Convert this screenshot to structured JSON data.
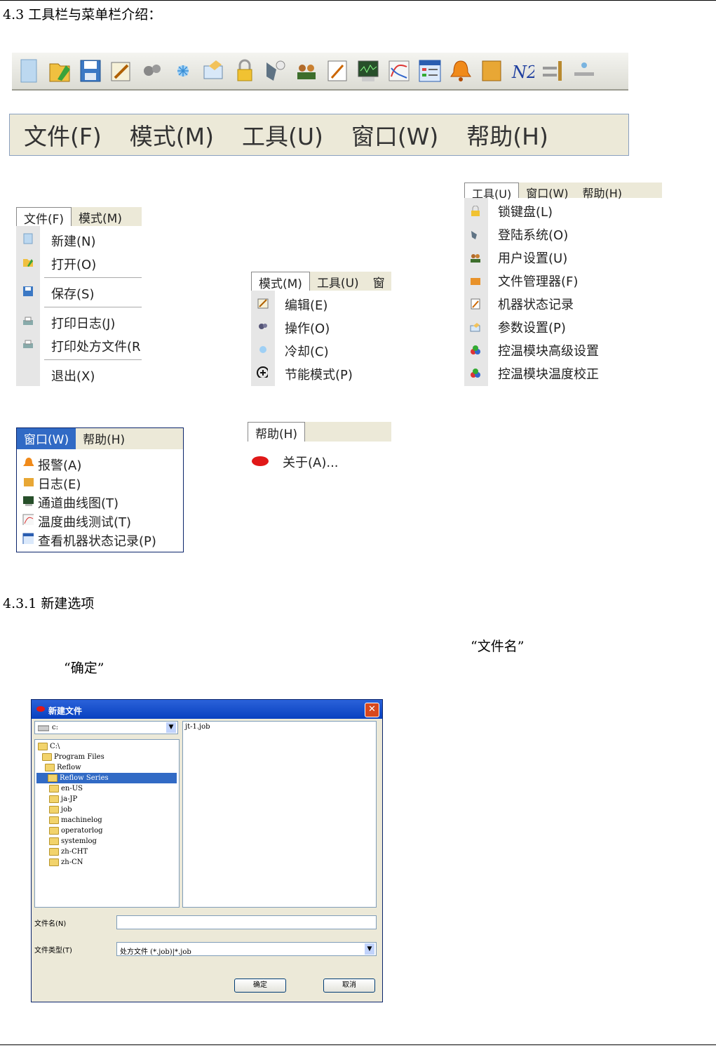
{
  "heading_main": "4.3 工具栏与菜单栏介绍：",
  "menubar": [
    "文件(F)",
    "模式(M)",
    "工具(U)",
    "窗口(W)",
    "帮助(H)"
  ],
  "toolbar_icons": [
    "new-file-icon",
    "open-icon",
    "save-icon",
    "edit-icon",
    "operate-icon",
    "cool-icon",
    "parameter-icon",
    "lock-icon",
    "login-icon",
    "users-icon",
    "status-record-icon",
    "channel-curve-icon",
    "temperature-curve-icon",
    "machine-status-icon",
    "alarm-bell-icon",
    "log-icon",
    "n2-icon",
    "conveyor-icon",
    "chain-icon"
  ],
  "file_menu": {
    "bar": [
      "文件(F)",
      "模式(M)"
    ],
    "items": [
      "新建(N)",
      "打开(O)",
      "保存(S)",
      "打印日志(J)",
      "打印处方文件(R",
      "退出(X)"
    ]
  },
  "mode_menu": {
    "bar": [
      "模式(M)",
      "工具(U)",
      "窗"
    ],
    "items": [
      "编辑(E)",
      "操作(O)",
      "冷却(C)",
      "节能模式(P)"
    ]
  },
  "tools_menu": {
    "bar": [
      "工具(U)",
      "窗口(W)",
      "帮助(H)"
    ],
    "items": [
      "锁键盘(L)",
      "登陆系统(O)",
      "用户设置(U)",
      "文件管理器(F)",
      "机器状态记录",
      "参数设置(P)",
      "控温模块高级设置",
      "控温模块温度校正"
    ]
  },
  "window_menu": {
    "bar": [
      "窗口(W)",
      "帮助(H)"
    ],
    "items": [
      "报警(A)",
      "日志(E)",
      "通道曲线图(T)",
      "温度曲线测试(T)",
      "查看机器状态记录(P)"
    ]
  },
  "help_menu": {
    "bar": [
      "帮助(H)"
    ],
    "items": [
      "关于(A)..."
    ]
  },
  "heading_sub": "4.3.1 新建选项",
  "quote_filename": "“文件名”",
  "quote_ok": "“确定”",
  "dialog": {
    "title": "新建文件",
    "drive": "c:",
    "file": "jt-1.job",
    "tree": [
      "C:\\",
      "Program Files",
      "Reflow",
      "Reflow Series",
      "en-US",
      "ja-JP",
      "job",
      "machinelog",
      "operatorlog",
      "systemlog",
      "zh-CHT",
      "zh-CN"
    ],
    "filename_label": "文件名(N)",
    "filetype_label": "文件类型(T)",
    "filetype_value": "处方文件 (*.job)|*.job",
    "ok": "确定",
    "cancel": "取消"
  }
}
